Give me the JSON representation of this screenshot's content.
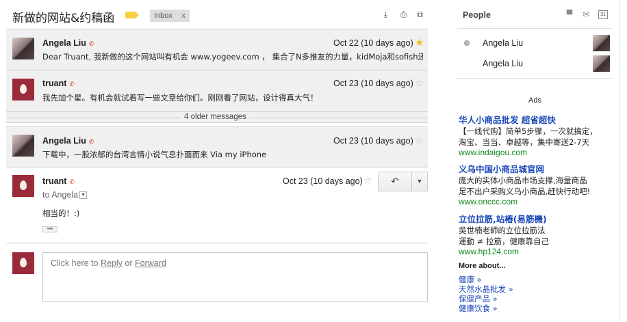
{
  "thread": {
    "subject": "新做的网站&约稿函",
    "label": "Inbox",
    "label_close": "x",
    "icons": [
      "download-icon",
      "print-icon",
      "new-window-icon"
    ]
  },
  "messages": [
    {
      "sender": "Angela Liu",
      "date": "Oct 22 (10 days ago)",
      "snippet": "Dear Truant, 我新做的这个网站叫有机会 www.yogeev.com ， 集合了N多推友的力量，kidMoja和sofish还帮我修改了一些东西",
      "starred": true
    },
    {
      "sender": "truant",
      "date": "Oct 23 (10 days ago)",
      "snippet": "我先加个星。有机会就试着写一些文章给你们。刚刚看了网站，设计得真大气！",
      "starred": false
    },
    {
      "sender": "Angela Liu",
      "date": "Oct 23 (10 days ago)",
      "snippet": "下载中，一股浓郁的台湾言情小说气息扑面而来 Via my iPhone",
      "starred": false
    }
  ],
  "older_messages": "4 older messages",
  "expanded": {
    "sender": "truant",
    "date": "Oct 23 (10 days ago)",
    "to": "to Angela",
    "body": "相当的！:)",
    "dots": "•••"
  },
  "reply": {
    "prefix": "Click here to ",
    "reply_link": "Reply",
    "or": " or ",
    "forward_link": "Forward"
  },
  "people": {
    "title": "People",
    "list": [
      {
        "name": "Angela Liu"
      },
      {
        "name": "Angela Liu"
      }
    ],
    "calendar_day": "31"
  },
  "ads": {
    "heading": "Ads",
    "items": [
      {
        "title": "华人小商品批发 超省超快",
        "line1": "【一线代购】简单5步骤，一次就搞定，",
        "line2": "淘宝、当当、卓越等，集中寄送2-7天",
        "url": "www.indaigou.com"
      },
      {
        "title": "义乌中国小商品城官网",
        "line1": "庞大的实体小商品市场支撑,海量商品",
        "line2": "足不出户采购义乌小商品,赶快行动吧!",
        "url": "www.onccc.com"
      },
      {
        "title": "立位拉筋,站樁(易筋機)",
        "line1": "吳世楠老師的立位拉筋法",
        "line2": "運動 ≠ 拉筋，健康靠自己",
        "url": "www.hp124.com"
      }
    ]
  },
  "more_about": {
    "heading": "More about...",
    "links": [
      "健康 »",
      "天然水晶批发 »",
      "保健产品 »",
      "健康饮食 »"
    ]
  },
  "colors": {
    "star_on": "#f2c127",
    "chat_red": "#d53c2b",
    "ad_link": "#1a47b8",
    "ad_url": "#0f8a1f",
    "label_yellow": "#f5d140"
  }
}
